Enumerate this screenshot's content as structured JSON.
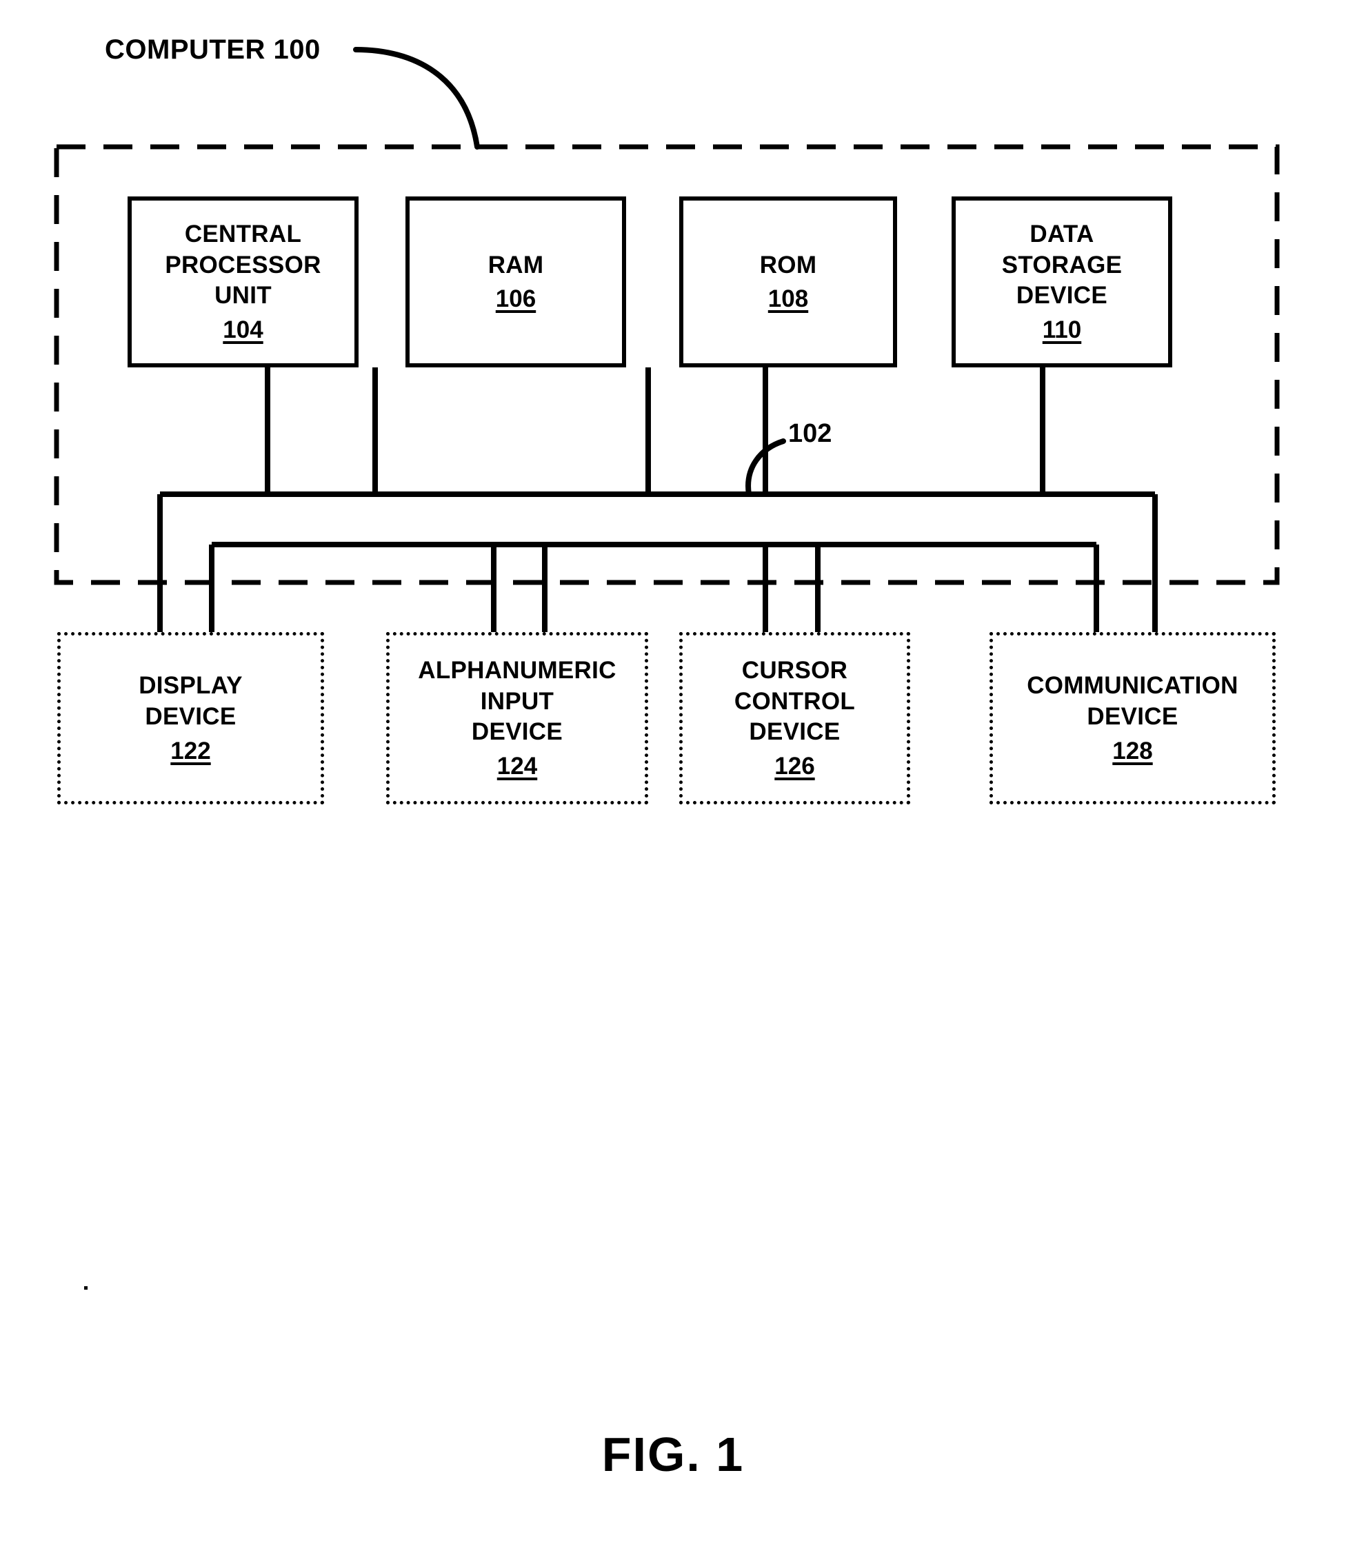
{
  "figure": {
    "caption": "FIG. 1",
    "system_label": "COMPUTER 100",
    "bus_ref": "102"
  },
  "enclosure": {
    "name": "computer-enclosure",
    "style": "dashed",
    "label": "COMPUTER 100"
  },
  "internal_units": [
    {
      "id": "cpu",
      "title": "CENTRAL\nPROCESSOR\nUNIT",
      "ref": "104"
    },
    {
      "id": "ram",
      "title": "RAM",
      "ref": "106"
    },
    {
      "id": "rom",
      "title": "ROM",
      "ref": "108"
    },
    {
      "id": "data-storage",
      "title": "DATA\nSTORAGE\nDEVICE",
      "ref": "110"
    }
  ],
  "external_units": [
    {
      "id": "display",
      "title": "DISPLAY\nDEVICE",
      "ref": "122"
    },
    {
      "id": "alphanumeric-input",
      "title": "ALPHANUMERIC\nINPUT\nDEVICE",
      "ref": "124"
    },
    {
      "id": "cursor-control",
      "title": "CURSOR\nCONTROL\nDEVICE",
      "ref": "126"
    },
    {
      "id": "communication",
      "title": "COMMUNICATION\nDEVICE",
      "ref": "128"
    }
  ],
  "colors": {
    "ink": "#000000",
    "paper": "#ffffff"
  }
}
